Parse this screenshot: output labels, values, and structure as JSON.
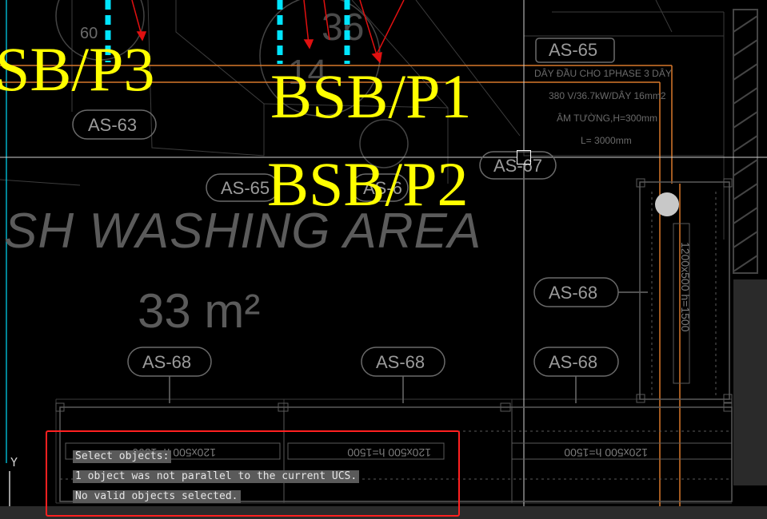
{
  "drawing": {
    "panel_labels": [
      "SB/P3",
      "BSB/P1",
      "BSB/P2"
    ],
    "room_name": "SH WASHING AREA",
    "room_area": "33 m²",
    "tags": [
      "AS-63",
      "AS-65",
      "AS-6",
      "AS-67",
      "AS-65",
      "AS-68",
      "AS-68",
      "AS-68",
      "AS-68"
    ],
    "trench_note": "120x500 h=1500",
    "vertical_trench_note": "1200x500 h=1500",
    "circle_numbers": [
      "36",
      "60",
      "14"
    ],
    "cable_note": {
      "line1": "DÂY ĐẦU CHO 1PHASE 3 DÂY",
      "line2": "380 V/36.7kW/DÂY 16mm2",
      "line3": "ÂM TƯỜNG,H=300mm",
      "line4": "L= 3000mm"
    }
  },
  "command_line": {
    "lines": [
      "Select objects:",
      "1 object was not parallel to the current UCS.",
      "No valid objects selected."
    ]
  },
  "ucs_icon": {
    "y_label": "Y"
  },
  "colors": {
    "background": "#000000",
    "panel_text": "#ffff00",
    "orange_line": "#d8782a",
    "cyan_line": "#00e5ff",
    "highlight_box": "#ff2020"
  }
}
